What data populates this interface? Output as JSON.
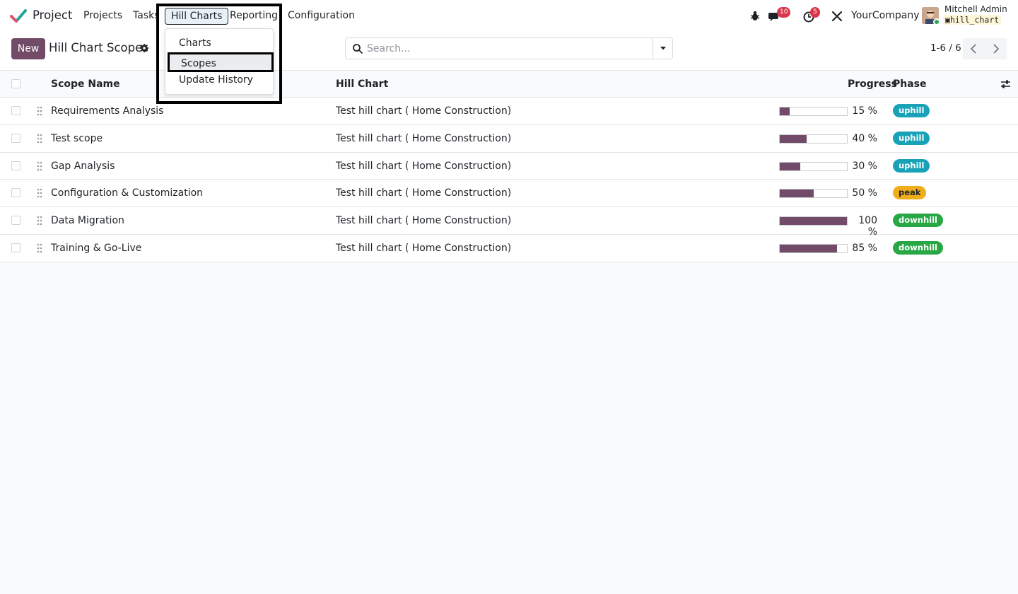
{
  "navbar": {
    "app_name": "Project",
    "menu": [
      "Projects",
      "Tasks",
      "Hill Charts",
      "Reporting",
      "Configuration"
    ],
    "active_menu": "Hill Charts",
    "messages_badge": "10",
    "activities_badge": "5",
    "company": "YourCompany",
    "user_name": "Mitchell Admin",
    "database": "hill_chart",
    "brand_color": "#714b67"
  },
  "dropdown": {
    "items": [
      "Charts",
      "Scopes",
      "Update History"
    ],
    "selected": "Scopes"
  },
  "control": {
    "new_label": "New",
    "title": "Hill Chart Scopes",
    "search_placeholder": "Search...",
    "pager": "1-6 / 6"
  },
  "list": {
    "columns": [
      "Scope Name",
      "Hill Chart",
      "Progress",
      "Phase"
    ],
    "rows": [
      {
        "name": "Requirements Analysis",
        "hill_chart": "Test hill chart ( Home Construction)",
        "progress": 15,
        "progress_label": "15 %",
        "phase": "uphill"
      },
      {
        "name": "Test scope",
        "hill_chart": "Test hill chart ( Home Construction)",
        "progress": 40,
        "progress_label": "40 %",
        "phase": "uphill"
      },
      {
        "name": "Gap Analysis",
        "hill_chart": "Test hill chart ( Home Construction)",
        "progress": 30,
        "progress_label": "30 %",
        "phase": "uphill"
      },
      {
        "name": "Configuration & Customization",
        "hill_chart": "Test hill chart ( Home Construction)",
        "progress": 50,
        "progress_label": "50 %",
        "phase": "peak"
      },
      {
        "name": "Data Migration",
        "hill_chart": "Test hill chart ( Home Construction)",
        "progress": 100,
        "progress_label": "100 %",
        "phase": "downhill"
      },
      {
        "name": "Training & Go-Live",
        "hill_chart": "Test hill chart ( Home Construction)",
        "progress": 85,
        "progress_label": "85 %",
        "phase": "downhill"
      }
    ],
    "phase_colors": {
      "uphill": "#17a2b8",
      "peak": "#f0ad1a",
      "downhill": "#28a745"
    }
  }
}
